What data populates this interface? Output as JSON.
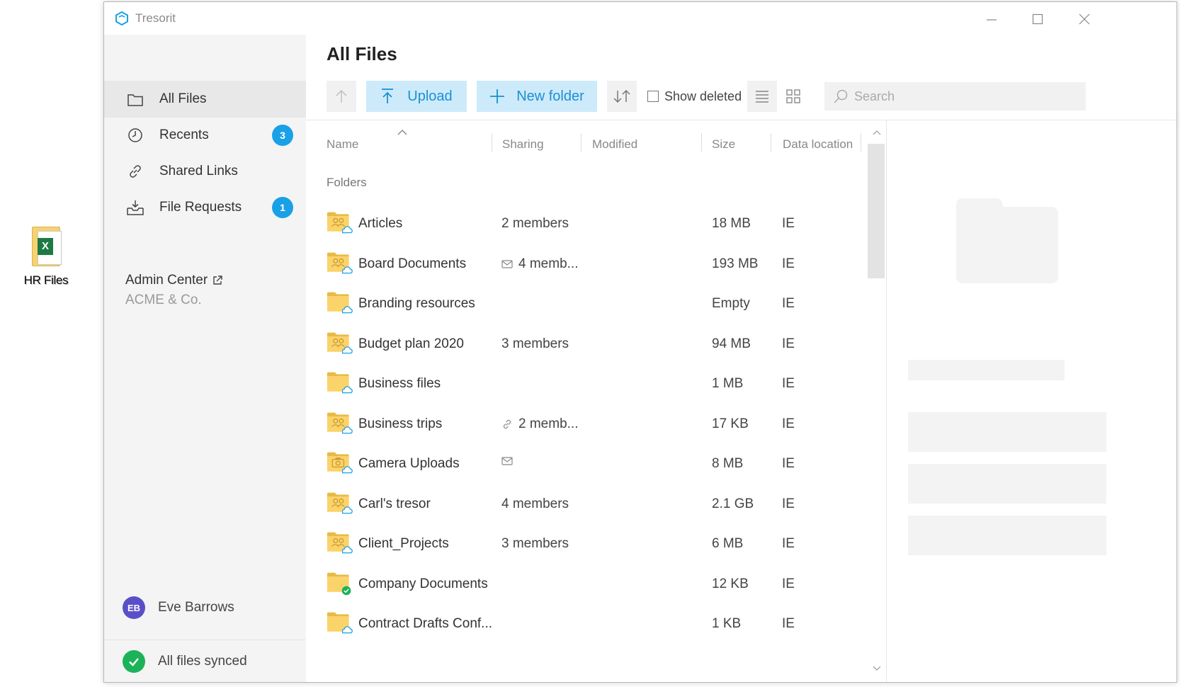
{
  "desktop": {
    "icon_label": "HR Files",
    "icon_badge": "X"
  },
  "window": {
    "title": "Tresorit"
  },
  "sidebar": {
    "items": [
      {
        "label": "All Files",
        "icon": "folder-icon",
        "badge": null
      },
      {
        "label": "Recents",
        "icon": "clock-icon",
        "badge": "3"
      },
      {
        "label": "Shared Links",
        "icon": "link-icon",
        "badge": null
      },
      {
        "label": "File Requests",
        "icon": "inbox-download-icon",
        "badge": "1"
      }
    ],
    "admin_title": "Admin Center",
    "admin_org": "ACME & Co.",
    "user_initials": "EB",
    "user_name": "Eve Barrows",
    "sync_status": "All files synced"
  },
  "main": {
    "title": "All Files",
    "toolbar": {
      "upload_label": "Upload",
      "new_folder_label": "New folder",
      "show_deleted_label": "Show deleted",
      "search_placeholder": "Search"
    },
    "columns": [
      "Name",
      "Sharing",
      "Modified",
      "Size",
      "Data location"
    ],
    "section_label": "Folders",
    "rows": [
      {
        "name": "Articles",
        "sharing": "2 members",
        "sharing_icon": null,
        "size": "18 MB",
        "location": "IE",
        "folder_type": "shared",
        "status": "cloud"
      },
      {
        "name": "Board Documents",
        "sharing": "4 memb...",
        "sharing_icon": "mail-icon",
        "size": "193 MB",
        "location": "IE",
        "folder_type": "shared",
        "status": "cloud"
      },
      {
        "name": "Branding resources",
        "sharing": "",
        "sharing_icon": null,
        "size": "Empty",
        "location": "IE",
        "folder_type": "plain",
        "status": "cloud"
      },
      {
        "name": "Budget plan 2020",
        "sharing": "3 members",
        "sharing_icon": null,
        "size": "94 MB",
        "location": "IE",
        "folder_type": "shared",
        "status": "cloud"
      },
      {
        "name": "Business files",
        "sharing": "",
        "sharing_icon": null,
        "size": "1 MB",
        "location": "IE",
        "folder_type": "plain",
        "status": "cloud"
      },
      {
        "name": "Business trips",
        "sharing": "2 memb...",
        "sharing_icon": "link-icon",
        "size": "17 KB",
        "location": "IE",
        "folder_type": "shared",
        "status": "cloud"
      },
      {
        "name": "Camera Uploads",
        "sharing": "",
        "sharing_icon": "mail-icon",
        "size": "8 MB",
        "location": "IE",
        "folder_type": "camera",
        "status": "cloud"
      },
      {
        "name": "Carl's tresor",
        "sharing": "4 members",
        "sharing_icon": null,
        "size": "2.1 GB",
        "location": "IE",
        "folder_type": "shared",
        "status": "cloud"
      },
      {
        "name": "Client_Projects",
        "sharing": "3 members",
        "sharing_icon": null,
        "size": "6 MB",
        "location": "IE",
        "folder_type": "shared",
        "status": "cloud"
      },
      {
        "name": "Company Documents",
        "sharing": "",
        "sharing_icon": null,
        "size": "12 KB",
        "location": "IE",
        "folder_type": "plain",
        "status": "synced"
      },
      {
        "name": "Contract Drafts Conf...",
        "sharing": "",
        "sharing_icon": null,
        "size": "1 KB",
        "location": "IE",
        "folder_type": "plain",
        "status": "cloud"
      }
    ]
  },
  "colors": {
    "accent": "#1aa0e6",
    "button_bg": "#cdeafa",
    "folder": "#fbd36b",
    "synced": "#1cb25a",
    "avatar": "#5b4fc9"
  }
}
